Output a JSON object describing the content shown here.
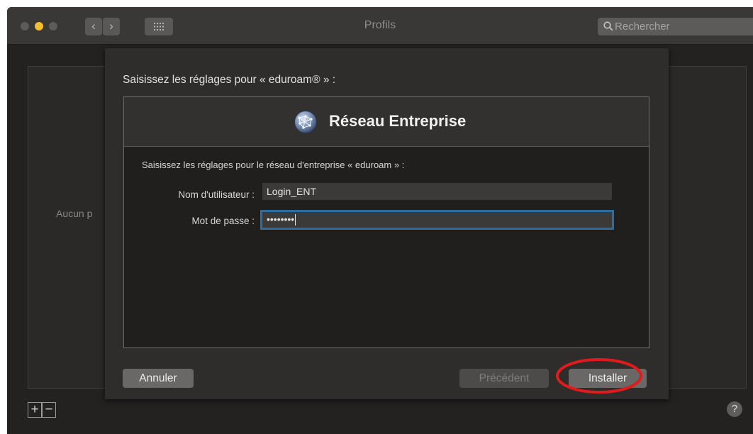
{
  "window": {
    "title": "Profils"
  },
  "toolbar": {
    "back_icon": "chevron-left",
    "forward_icon": "chevron-right",
    "grid_icon": "grid-icon"
  },
  "search": {
    "placeholder": "Rechercher"
  },
  "pane": {
    "empty_text": "Aucun p"
  },
  "bottom": {
    "add_label": "+",
    "remove_label": "−",
    "help_label": "?"
  },
  "sheet": {
    "heading": "Saisissez les réglages pour « eduroam® » :",
    "panel_title": "Réseau Entreprise",
    "description": "Saisissez les réglages pour le réseau d'entreprise « eduroam » :",
    "username_label": "Nom d'utilisateur :",
    "username_value": "Login_ENT",
    "password_label": "Mot de passe :",
    "password_value": "••••••••",
    "cancel_label": "Annuler",
    "previous_label": "Précédent",
    "install_label": "Installer"
  },
  "colors": {
    "accent": "#2f6c9e",
    "highlight": "#e01b1b",
    "yellow": "#f5be2e"
  }
}
